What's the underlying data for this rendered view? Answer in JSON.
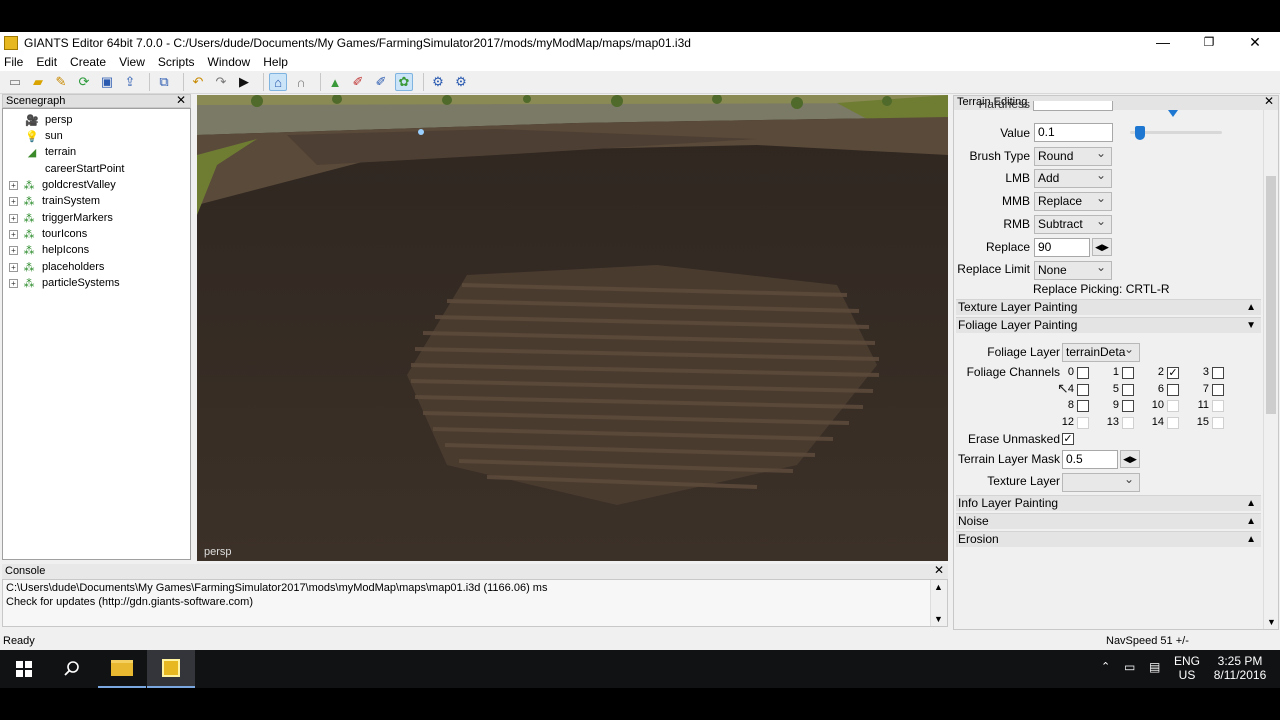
{
  "window": {
    "title": "GIANTS Editor 64bit 7.0.0 - C:/Users/dude/Documents/My Games/FarmingSimulator2017/mods/myModMap/maps/map01.i3d",
    "minimize": "—",
    "maximize": "❐",
    "close": "✕"
  },
  "menu": [
    "File",
    "Edit",
    "Create",
    "View",
    "Scripts",
    "Window",
    "Help"
  ],
  "scenegraph": {
    "title": "Scenegraph",
    "close": "✕",
    "items": [
      {
        "label": "persp",
        "icon": "camera-icon",
        "expandable": false
      },
      {
        "label": "sun",
        "icon": "light-bulb-icon",
        "expandable": false
      },
      {
        "label": "terrain",
        "icon": "terrain-icon",
        "expandable": false
      },
      {
        "label": "careerStartPoint",
        "icon": "none",
        "expandable": false
      },
      {
        "label": "goldcrestValley",
        "icon": "transform-group-icon",
        "expandable": true
      },
      {
        "label": "trainSystem",
        "icon": "transform-group-icon",
        "expandable": true
      },
      {
        "label": "triggerMarkers",
        "icon": "transform-group-icon",
        "expandable": true
      },
      {
        "label": "tourIcons",
        "icon": "transform-group-icon",
        "expandable": true
      },
      {
        "label": "helpIcons",
        "icon": "transform-group-icon",
        "expandable": true
      },
      {
        "label": "placeholders",
        "icon": "transform-group-icon",
        "expandable": true
      },
      {
        "label": "particleSystems",
        "icon": "transform-group-icon",
        "expandable": true
      }
    ]
  },
  "viewport": {
    "camera_label": "persp"
  },
  "console": {
    "title": "Console",
    "close": "✕",
    "lines": [
      "C:\\Users\\dude\\Documents\\My Games\\FarmingSimulator2017\\mods\\myModMap\\maps\\map01.i3d (1166.06) ms",
      "Check for updates (http://gdn.giants-software.com)"
    ]
  },
  "status": {
    "left": "Ready",
    "right": "NavSpeed 51 +/-"
  },
  "terrain_editing": {
    "title": "Terrain Editing",
    "close": "✕",
    "hardness_label": "Hardness",
    "value_label": "Value",
    "value": "0.1",
    "value_slider_level": 0.05,
    "brush_type_label": "Brush Type",
    "brush_type": "Round",
    "lmb_label": "LMB",
    "lmb": "Add",
    "mmb_label": "MMB",
    "mmb": "Replace",
    "rmb_label": "RMB",
    "rmb": "Subtract",
    "replace_label": "Replace",
    "replace": "90",
    "replace_limit_label": "Replace Limit",
    "replace_limit": "None",
    "replace_picking": "Replace Picking: CRTL-R",
    "sections": {
      "texture_layer_painting": "Texture Layer Painting",
      "foliage_layer_painting": "Foliage Layer Painting",
      "info_layer_painting": "Info Layer Painting",
      "noise": "Noise",
      "erosion": "Erosion"
    },
    "foliage_layer_label": "Foliage Layer",
    "foliage_layer": "terrainDeta",
    "foliage_channels_label": "Foliage Channels",
    "channels": [
      {
        "n": "0",
        "checked": false,
        "enabled": true
      },
      {
        "n": "1",
        "checked": false,
        "enabled": true
      },
      {
        "n": "2",
        "checked": true,
        "enabled": true
      },
      {
        "n": "3",
        "checked": false,
        "enabled": true
      },
      {
        "n": "4",
        "checked": false,
        "enabled": true
      },
      {
        "n": "5",
        "checked": false,
        "enabled": true
      },
      {
        "n": "6",
        "checked": false,
        "enabled": true
      },
      {
        "n": "7",
        "checked": false,
        "enabled": true
      },
      {
        "n": "8",
        "checked": false,
        "enabled": true
      },
      {
        "n": "9",
        "checked": false,
        "enabled": true
      },
      {
        "n": "10",
        "checked": false,
        "enabled": false
      },
      {
        "n": "11",
        "checked": false,
        "enabled": false
      },
      {
        "n": "12",
        "checked": false,
        "enabled": false
      },
      {
        "n": "13",
        "checked": false,
        "enabled": false
      },
      {
        "n": "14",
        "checked": false,
        "enabled": false
      },
      {
        "n": "15",
        "checked": false,
        "enabled": false
      }
    ],
    "erase_unmasked_label": "Erase Unmasked",
    "erase_unmasked": true,
    "terrain_layer_mask_label": "Terrain Layer Mask",
    "terrain_layer_mask": "0.5",
    "texture_layer_label": "Texture Layer",
    "texture_layer": ""
  },
  "taskbar": {
    "language": "ENG",
    "region": "US",
    "time": "3:25 PM",
    "date": "8/11/2016"
  },
  "colors": {
    "accent": "#1e78d2",
    "soil": "#3a2f26",
    "grass": "#6f7d33"
  }
}
